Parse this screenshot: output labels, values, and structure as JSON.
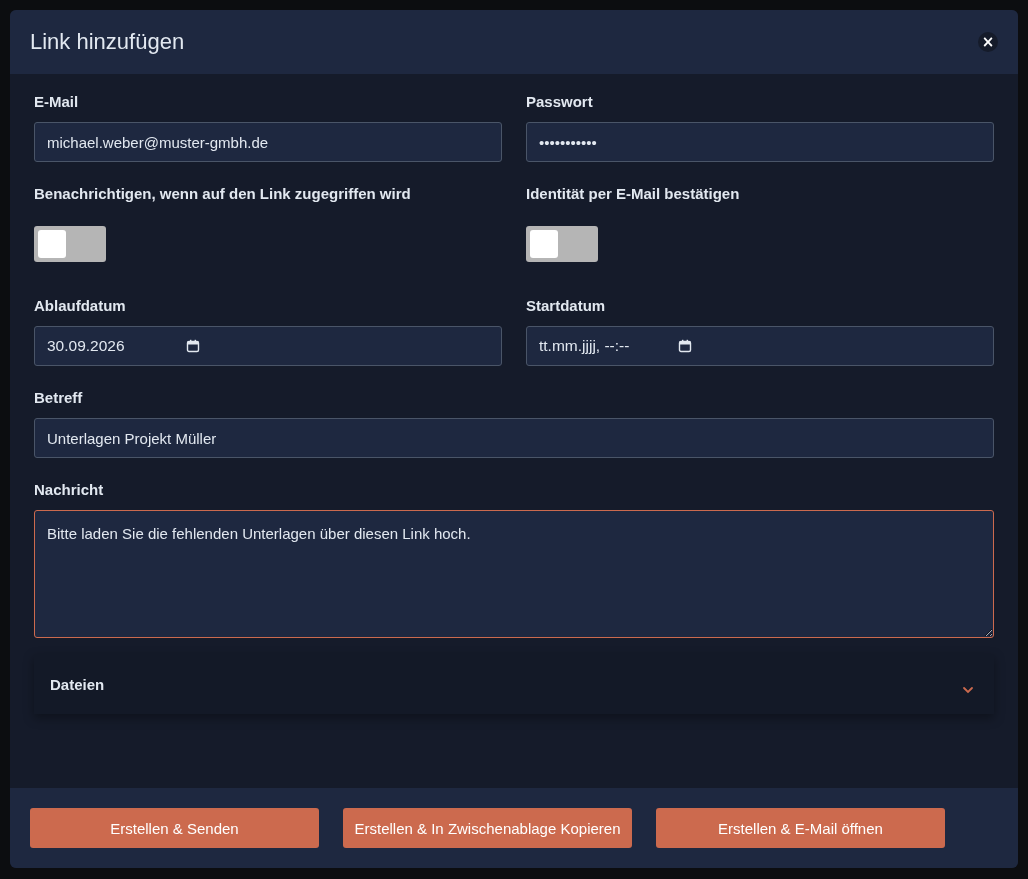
{
  "dialog": {
    "title": "Link hinzufügen",
    "close": "×"
  },
  "fields": [
    {
      "kind": "text",
      "label": "E-Mail",
      "value": "michael.weber@muster-gmbh.de"
    },
    {
      "kind": "text",
      "label": "Passwort",
      "value": "•••••••••••"
    },
    {
      "kind": "toggle",
      "label": "Benachrichtigen, wenn auf den Link zugegriffen wird",
      "on": false
    },
    {
      "kind": "toggle",
      "label": "Identität per E-Mail bestätigen",
      "on": false
    },
    {
      "kind": "date",
      "label": "Ablaufdatum",
      "value": "30.09.2026"
    },
    {
      "kind": "date",
      "label": "Startdatum",
      "value": "tt.mm.jjjj, --:--"
    },
    {
      "kind": "wide",
      "label": "Betreff",
      "value": "Unterlagen Projekt Müller"
    },
    {
      "kind": "area",
      "label": "Nachricht",
      "value": "Bitte laden Sie die fehlenden Unterlagen über diesen Link hoch.",
      "focused": true
    }
  ],
  "section": {
    "title": "Dateien",
    "expanded": false
  },
  "buttons": [
    "Erstellen & Senden",
    "Erstellen & In Zwischenablage Kopieren",
    "Erstellen & E-Mail öffnen"
  ]
}
